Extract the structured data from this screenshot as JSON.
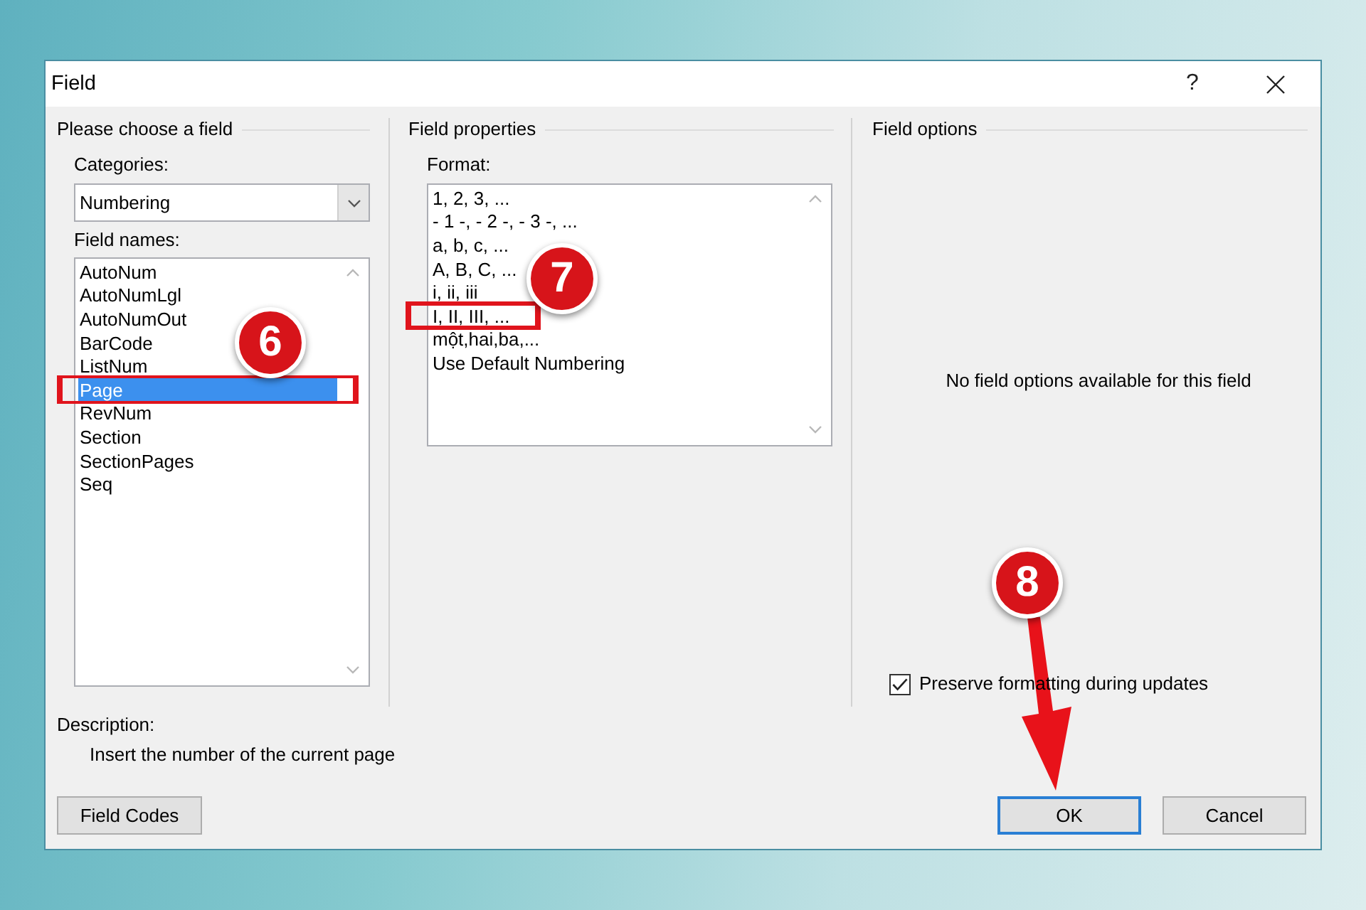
{
  "window": {
    "title": "Field",
    "help_button": "?"
  },
  "field_chooser": {
    "title": "Please choose a field",
    "categories": {
      "label": "Categories:",
      "value": "Numbering"
    },
    "field_names": {
      "label": "Field names:",
      "items": [
        {
          "label": "AutoNum",
          "selected": false
        },
        {
          "label": "AutoNumLgl",
          "selected": false
        },
        {
          "label": "AutoNumOut",
          "selected": false
        },
        {
          "label": "BarCode",
          "selected": false
        },
        {
          "label": "ListNum",
          "selected": false
        },
        {
          "label": "Page",
          "selected": true
        },
        {
          "label": "RevNum",
          "selected": false
        },
        {
          "label": "Section",
          "selected": false
        },
        {
          "label": "SectionPages",
          "selected": false
        },
        {
          "label": "Seq",
          "selected": false
        }
      ]
    }
  },
  "field_properties": {
    "title": "Field properties",
    "format": {
      "label": "Format:",
      "items": [
        {
          "label": "1, 2, 3, ...",
          "selected": false
        },
        {
          "label": "- 1 -, - 2 -, - 3 -, ...",
          "selected": false
        },
        {
          "label": "a, b, c, ...",
          "selected": false
        },
        {
          "label": "A, B, C, ...",
          "selected": false
        },
        {
          "label": "i, ii, iii",
          "selected": false
        },
        {
          "label": "I, II, III, ...",
          "selected": false
        },
        {
          "label": "một,hai,ba,...",
          "selected": false
        },
        {
          "label": "Use Default Numbering",
          "selected": false
        }
      ]
    }
  },
  "field_options": {
    "title": "Field options",
    "message": "No field options available for this field",
    "preserve_formatting": {
      "label": "Preserve formatting during updates",
      "checked": true
    }
  },
  "description": {
    "label": "Description:",
    "text": "Insert the number of the current page"
  },
  "buttons": [
    {
      "label": "Field Codes",
      "kind": "secondary"
    },
    {
      "label": "OK",
      "kind": "default"
    },
    {
      "label": "Cancel",
      "kind": "secondary"
    }
  ],
  "annotations": [
    {
      "label": "6"
    },
    {
      "label": "7"
    },
    {
      "label": "8"
    }
  ]
}
